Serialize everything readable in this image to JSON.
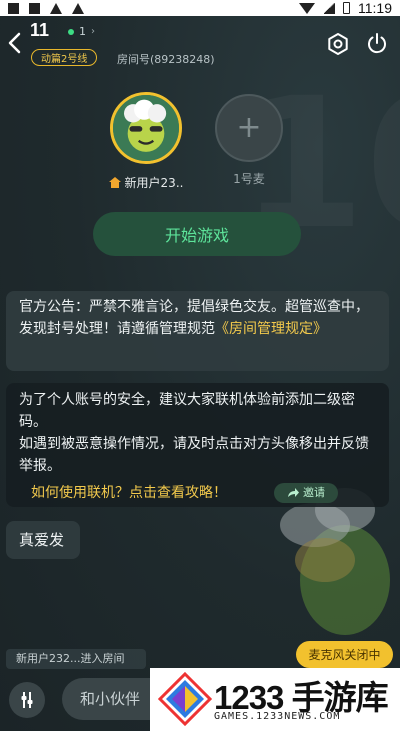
{
  "status_bar": {
    "time": "11:19"
  },
  "header": {
    "room_title": "11",
    "online_count": "1",
    "channel_tag": "动篇2号线",
    "room_number": "房间号(89238248)"
  },
  "seats": [
    {
      "name": "新用户23..",
      "role": "owner"
    },
    {
      "name": "1号麦",
      "role": "empty"
    }
  ],
  "start_button": "开始游戏",
  "chat": {
    "notice_text": "官方公告：严禁不雅言论，提倡绿色交友。超管巡查中，发现封号处理！请遵循管理规范",
    "notice_link": "《房间管理规定》",
    "tips_line1": "为了个人账号的安全，建议大家联机体验前添加二级密码。",
    "tips_line2": "如遇到被恶意操作情况，请及时点击对方头像移出并反馈举报。",
    "guide_link": "如何使用联机？点击查看攻略！",
    "invite_label": "邀请",
    "user_message": "真爱发",
    "join_notice": "新用户232...进入房间"
  },
  "mic_status": "麦克风关闭中",
  "input": {
    "placeholder": "和小伙伴"
  },
  "watermark": {
    "brand": "1233 手游库",
    "domain": "GAMES.1233NEWS.COM"
  },
  "colors": {
    "accent": "#f2c12e",
    "green": "#5de39a",
    "background": "#1f2a2d"
  }
}
